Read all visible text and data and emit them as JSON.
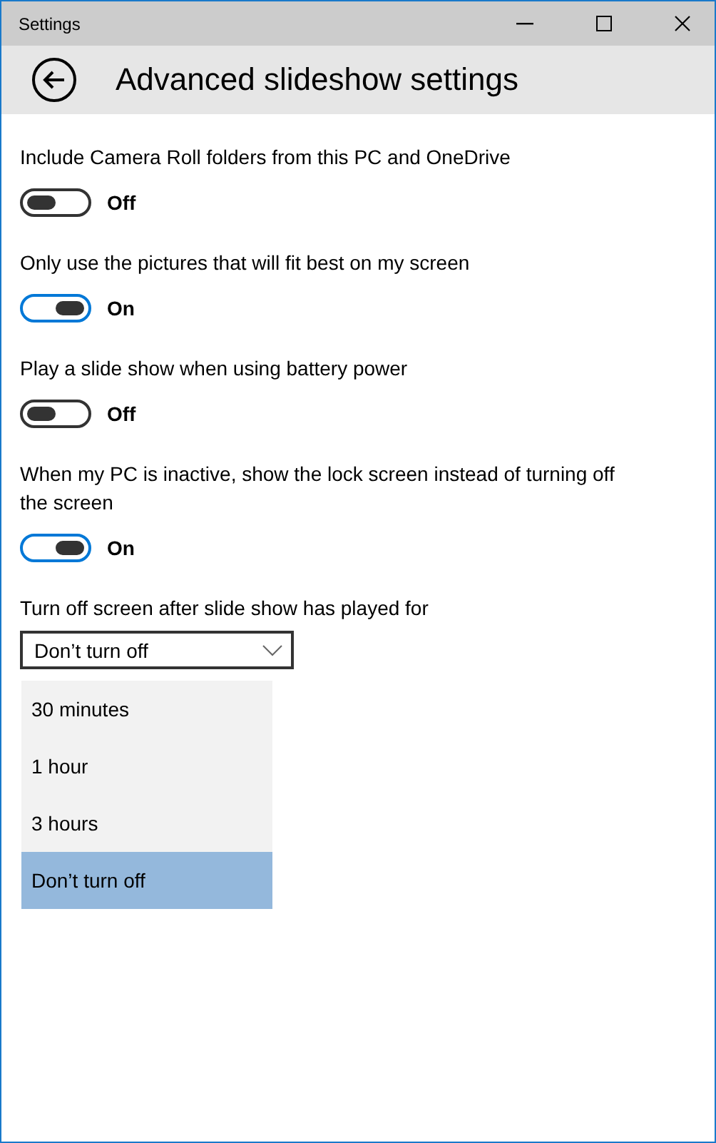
{
  "window": {
    "title": "Settings"
  },
  "header": {
    "title": "Advanced slideshow settings"
  },
  "settings": [
    {
      "label": "Include Camera Roll folders from this PC and OneDrive",
      "on": false,
      "state_label": "Off"
    },
    {
      "label": "Only use the pictures that will fit best on my screen",
      "on": true,
      "state_label": "On"
    },
    {
      "label": "Play a slide show when using battery power",
      "on": false,
      "state_label": "Off"
    },
    {
      "label": "When my PC is inactive, show the lock screen instead of turning off the screen",
      "on": true,
      "state_label": "On"
    }
  ],
  "dropdown": {
    "label": "Turn off screen after slide show has played for",
    "value": "Don’t turn off",
    "expanded": true,
    "options": [
      {
        "label": "30 minutes",
        "selected": false
      },
      {
        "label": "1 hour",
        "selected": false
      },
      {
        "label": "3 hours",
        "selected": false
      },
      {
        "label": "Don’t turn off",
        "selected": true
      }
    ]
  }
}
